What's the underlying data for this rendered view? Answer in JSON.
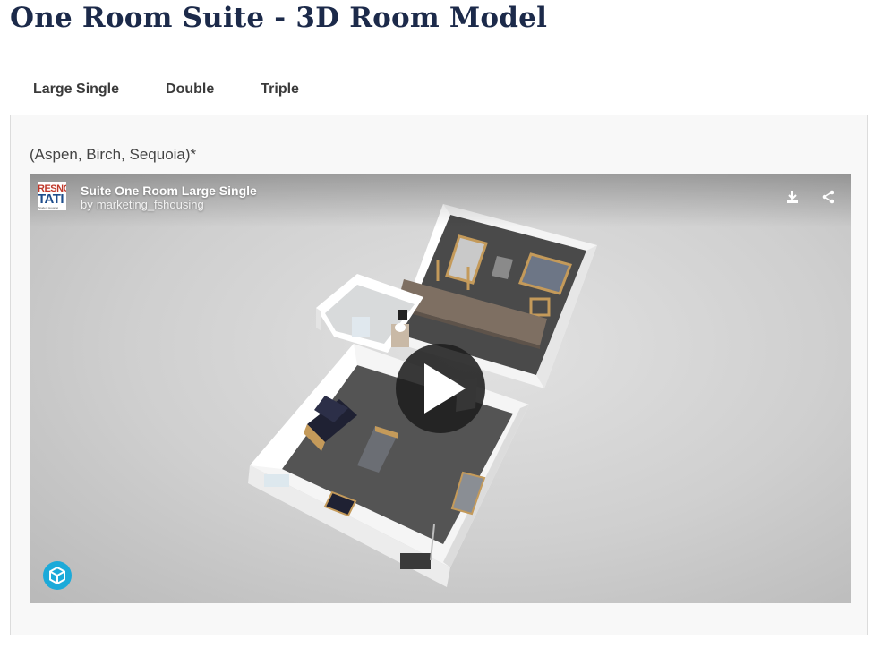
{
  "page": {
    "title": "One Room Suite - 3D Room Model"
  },
  "tabs": [
    {
      "label": "Large Single",
      "active": true
    },
    {
      "label": "Double",
      "active": false
    },
    {
      "label": "Triple",
      "active": false
    }
  ],
  "panel": {
    "subtitle": "(Aspen, Birch, Sequoia)*"
  },
  "viewer": {
    "model_title": "Suite One Room Large Single",
    "byline_prefix": "by",
    "author": "marketing_fshousing",
    "author_logo_text": [
      "RESNC",
      "TATI",
      "Student Housing"
    ],
    "icons": {
      "download": "download-icon",
      "share": "share-icon",
      "play": "play-icon",
      "brand": "sketchfab-logo-icon"
    },
    "colors": {
      "play_button": "#1e1e1e",
      "brand_logo": "#1caad9",
      "title_color": "#1c2a4a"
    }
  }
}
